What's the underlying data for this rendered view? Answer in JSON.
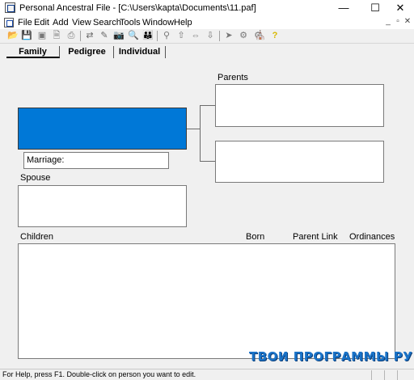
{
  "window": {
    "title": "Personal Ancestral File - [C:\\Users\\kapta\\Documents\\11.paf]",
    "controls": {
      "minimize": "—",
      "maximize": "☐",
      "close": "✕"
    }
  },
  "menu": {
    "items": [
      "File",
      "Edit",
      "Add",
      "View",
      "Search",
      "Tools",
      "Window",
      "Help"
    ],
    "mdi_controls": {
      "minimize": "_",
      "restore": "▫",
      "close": "✕"
    }
  },
  "toolbar": {
    "buttons": [
      {
        "name": "open-file-icon",
        "glyph": "📂"
      },
      {
        "name": "save-icon",
        "glyph": "💾"
      },
      {
        "name": "backup-icon",
        "glyph": "▣"
      },
      {
        "name": "report-icon",
        "glyph": "🗎"
      },
      {
        "name": "print-icon",
        "glyph": "⎙"
      },
      {
        "name": "merge-icon",
        "glyph": "⇄"
      },
      {
        "name": "edit-individual-icon",
        "glyph": "✎"
      },
      {
        "name": "camera-icon",
        "glyph": "📷"
      },
      {
        "name": "find-individual-icon",
        "glyph": "🔍"
      },
      {
        "name": "family-icon",
        "glyph": "👪"
      },
      {
        "name": "search-binoculars-icon",
        "glyph": "⚲"
      },
      {
        "name": "add-parents-icon",
        "glyph": "⇧"
      },
      {
        "name": "add-spouse-icon",
        "glyph": "⇔"
      },
      {
        "name": "add-child-icon",
        "glyph": "⇩"
      },
      {
        "name": "navigate-icon",
        "glyph": "➤"
      },
      {
        "name": "ordinances-icon",
        "glyph": "⚙"
      },
      {
        "name": "sources-icon",
        "glyph": "⚙"
      },
      {
        "name": "temple-icon",
        "glyph": "⛪"
      },
      {
        "name": "help-icon",
        "glyph": "?"
      }
    ],
    "colors": {
      "folder": "#d9a400",
      "disk": "#1b3f8f",
      "help": "#d8b800"
    }
  },
  "tabs": [
    {
      "label": "Family",
      "active": true
    },
    {
      "label": "Pedigree",
      "active": false
    },
    {
      "label": "Individual",
      "active": false
    }
  ],
  "family": {
    "parents_label": "Parents",
    "marriage_label": "Marriage:",
    "spouse_label": "Spouse",
    "primary_color": "#0078d7"
  },
  "children": {
    "label": "Children",
    "columns": [
      "Born",
      "Parent Link",
      "Ordinances"
    ]
  },
  "status": {
    "text": "For Help, press F1. Double-click on person you want to edit."
  },
  "watermark": "ТВОИ ПРОГРАММЫ РУ"
}
